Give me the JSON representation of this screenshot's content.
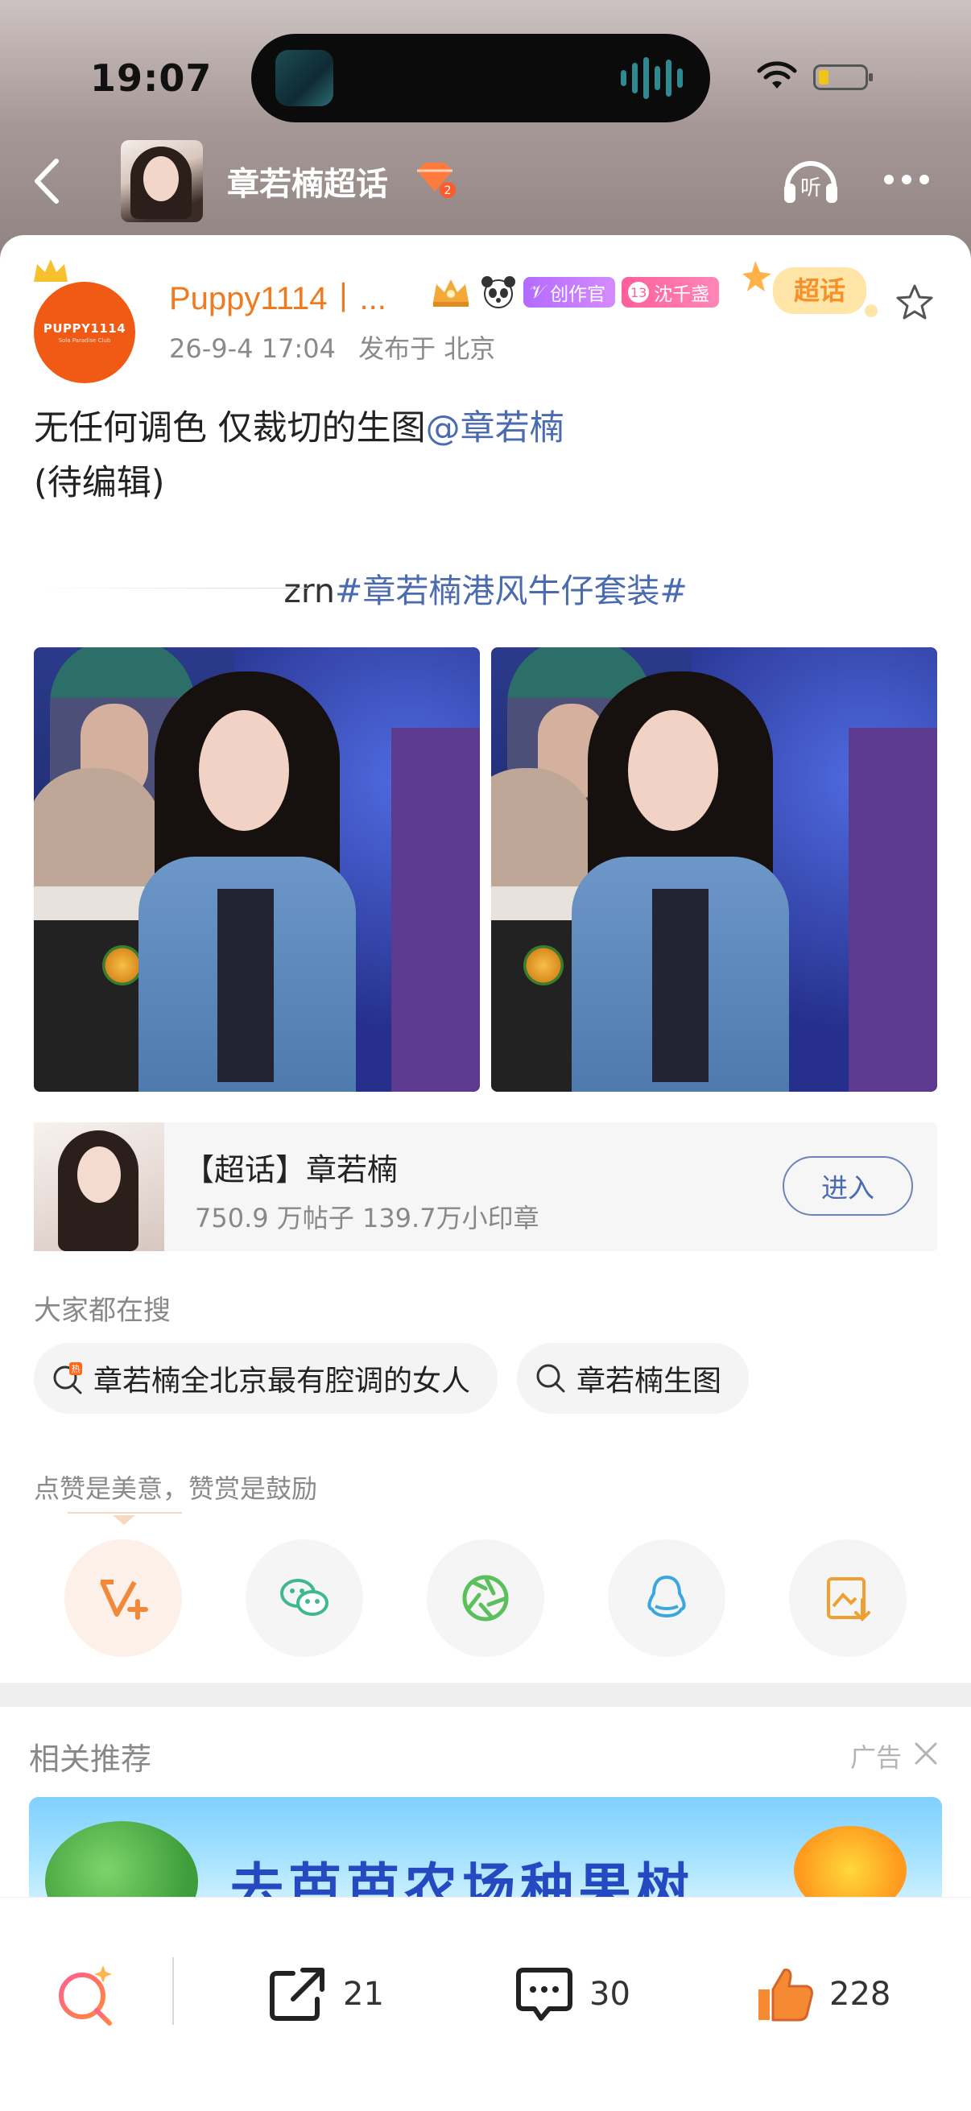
{
  "status_bar": {
    "time": "19:07"
  },
  "nav": {
    "topic_title": "章若楠超话"
  },
  "post": {
    "username": "Puppy1114丨...",
    "avatar_text_1": "PUPPY1114",
    "avatar_text_2": "Sola Paradise Club",
    "badges": {
      "creator": "创作官",
      "fan_level": "13",
      "fan_name": "沈千盏",
      "super_label": "超话"
    },
    "date": "26-9-4 17:04",
    "location": "发布于 北京",
    "text_line1": "无任何调色 仅裁切的生图",
    "mention": "@章若楠",
    "text_line2": "(待编辑)",
    "tag_prefix": "zrn",
    "hashtag": "#章若楠港风牛仔套装#"
  },
  "topic_card": {
    "title": "【超话】章若楠",
    "stats": "750.9 万帖子 139.7万小印章",
    "enter_label": "进入"
  },
  "search": {
    "title": "大家都在搜",
    "chips": [
      "章若楠全北京最有腔调的女人",
      "章若楠生图"
    ]
  },
  "appreciate": {
    "text": "点赞是美意，赞赏是鼓励"
  },
  "related": {
    "title": "相关推荐",
    "ad_label": "广告",
    "ad_text": "去芭芭农场种果树"
  },
  "bottom_bar": {
    "repost_count": "21",
    "comment_count": "30",
    "like_count": "228"
  },
  "colors": {
    "accent_orange": "#f07a1f",
    "link_blue": "#4a6bb0",
    "like_orange": "#f58a32"
  }
}
